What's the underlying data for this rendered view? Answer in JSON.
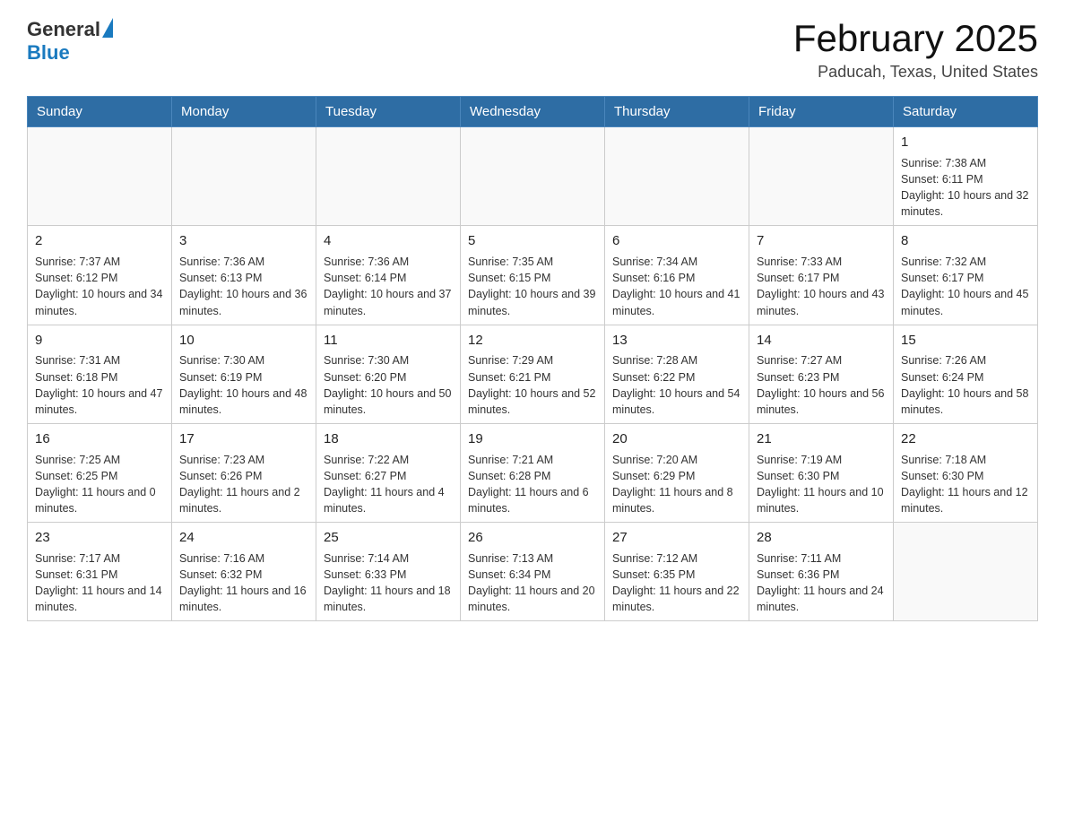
{
  "header": {
    "logo": {
      "general": "General",
      "blue": "Blue"
    },
    "title": "February 2025",
    "location": "Paducah, Texas, United States"
  },
  "days_of_week": [
    "Sunday",
    "Monday",
    "Tuesday",
    "Wednesday",
    "Thursday",
    "Friday",
    "Saturday"
  ],
  "weeks": [
    [
      {
        "day": "",
        "sunrise": "",
        "sunset": "",
        "daylight": ""
      },
      {
        "day": "",
        "sunrise": "",
        "sunset": "",
        "daylight": ""
      },
      {
        "day": "",
        "sunrise": "",
        "sunset": "",
        "daylight": ""
      },
      {
        "day": "",
        "sunrise": "",
        "sunset": "",
        "daylight": ""
      },
      {
        "day": "",
        "sunrise": "",
        "sunset": "",
        "daylight": ""
      },
      {
        "day": "",
        "sunrise": "",
        "sunset": "",
        "daylight": ""
      },
      {
        "day": "1",
        "sunrise": "Sunrise: 7:38 AM",
        "sunset": "Sunset: 6:11 PM",
        "daylight": "Daylight: 10 hours and 32 minutes."
      }
    ],
    [
      {
        "day": "2",
        "sunrise": "Sunrise: 7:37 AM",
        "sunset": "Sunset: 6:12 PM",
        "daylight": "Daylight: 10 hours and 34 minutes."
      },
      {
        "day": "3",
        "sunrise": "Sunrise: 7:36 AM",
        "sunset": "Sunset: 6:13 PM",
        "daylight": "Daylight: 10 hours and 36 minutes."
      },
      {
        "day": "4",
        "sunrise": "Sunrise: 7:36 AM",
        "sunset": "Sunset: 6:14 PM",
        "daylight": "Daylight: 10 hours and 37 minutes."
      },
      {
        "day": "5",
        "sunrise": "Sunrise: 7:35 AM",
        "sunset": "Sunset: 6:15 PM",
        "daylight": "Daylight: 10 hours and 39 minutes."
      },
      {
        "day": "6",
        "sunrise": "Sunrise: 7:34 AM",
        "sunset": "Sunset: 6:16 PM",
        "daylight": "Daylight: 10 hours and 41 minutes."
      },
      {
        "day": "7",
        "sunrise": "Sunrise: 7:33 AM",
        "sunset": "Sunset: 6:17 PM",
        "daylight": "Daylight: 10 hours and 43 minutes."
      },
      {
        "day": "8",
        "sunrise": "Sunrise: 7:32 AM",
        "sunset": "Sunset: 6:17 PM",
        "daylight": "Daylight: 10 hours and 45 minutes."
      }
    ],
    [
      {
        "day": "9",
        "sunrise": "Sunrise: 7:31 AM",
        "sunset": "Sunset: 6:18 PM",
        "daylight": "Daylight: 10 hours and 47 minutes."
      },
      {
        "day": "10",
        "sunrise": "Sunrise: 7:30 AM",
        "sunset": "Sunset: 6:19 PM",
        "daylight": "Daylight: 10 hours and 48 minutes."
      },
      {
        "day": "11",
        "sunrise": "Sunrise: 7:30 AM",
        "sunset": "Sunset: 6:20 PM",
        "daylight": "Daylight: 10 hours and 50 minutes."
      },
      {
        "day": "12",
        "sunrise": "Sunrise: 7:29 AM",
        "sunset": "Sunset: 6:21 PM",
        "daylight": "Daylight: 10 hours and 52 minutes."
      },
      {
        "day": "13",
        "sunrise": "Sunrise: 7:28 AM",
        "sunset": "Sunset: 6:22 PM",
        "daylight": "Daylight: 10 hours and 54 minutes."
      },
      {
        "day": "14",
        "sunrise": "Sunrise: 7:27 AM",
        "sunset": "Sunset: 6:23 PM",
        "daylight": "Daylight: 10 hours and 56 minutes."
      },
      {
        "day": "15",
        "sunrise": "Sunrise: 7:26 AM",
        "sunset": "Sunset: 6:24 PM",
        "daylight": "Daylight: 10 hours and 58 minutes."
      }
    ],
    [
      {
        "day": "16",
        "sunrise": "Sunrise: 7:25 AM",
        "sunset": "Sunset: 6:25 PM",
        "daylight": "Daylight: 11 hours and 0 minutes."
      },
      {
        "day": "17",
        "sunrise": "Sunrise: 7:23 AM",
        "sunset": "Sunset: 6:26 PM",
        "daylight": "Daylight: 11 hours and 2 minutes."
      },
      {
        "day": "18",
        "sunrise": "Sunrise: 7:22 AM",
        "sunset": "Sunset: 6:27 PM",
        "daylight": "Daylight: 11 hours and 4 minutes."
      },
      {
        "day": "19",
        "sunrise": "Sunrise: 7:21 AM",
        "sunset": "Sunset: 6:28 PM",
        "daylight": "Daylight: 11 hours and 6 minutes."
      },
      {
        "day": "20",
        "sunrise": "Sunrise: 7:20 AM",
        "sunset": "Sunset: 6:29 PM",
        "daylight": "Daylight: 11 hours and 8 minutes."
      },
      {
        "day": "21",
        "sunrise": "Sunrise: 7:19 AM",
        "sunset": "Sunset: 6:30 PM",
        "daylight": "Daylight: 11 hours and 10 minutes."
      },
      {
        "day": "22",
        "sunrise": "Sunrise: 7:18 AM",
        "sunset": "Sunset: 6:30 PM",
        "daylight": "Daylight: 11 hours and 12 minutes."
      }
    ],
    [
      {
        "day": "23",
        "sunrise": "Sunrise: 7:17 AM",
        "sunset": "Sunset: 6:31 PM",
        "daylight": "Daylight: 11 hours and 14 minutes."
      },
      {
        "day": "24",
        "sunrise": "Sunrise: 7:16 AM",
        "sunset": "Sunset: 6:32 PM",
        "daylight": "Daylight: 11 hours and 16 minutes."
      },
      {
        "day": "25",
        "sunrise": "Sunrise: 7:14 AM",
        "sunset": "Sunset: 6:33 PM",
        "daylight": "Daylight: 11 hours and 18 minutes."
      },
      {
        "day": "26",
        "sunrise": "Sunrise: 7:13 AM",
        "sunset": "Sunset: 6:34 PM",
        "daylight": "Daylight: 11 hours and 20 minutes."
      },
      {
        "day": "27",
        "sunrise": "Sunrise: 7:12 AM",
        "sunset": "Sunset: 6:35 PM",
        "daylight": "Daylight: 11 hours and 22 minutes."
      },
      {
        "day": "28",
        "sunrise": "Sunrise: 7:11 AM",
        "sunset": "Sunset: 6:36 PM",
        "daylight": "Daylight: 11 hours and 24 minutes."
      },
      {
        "day": "",
        "sunrise": "",
        "sunset": "",
        "daylight": ""
      }
    ]
  ]
}
